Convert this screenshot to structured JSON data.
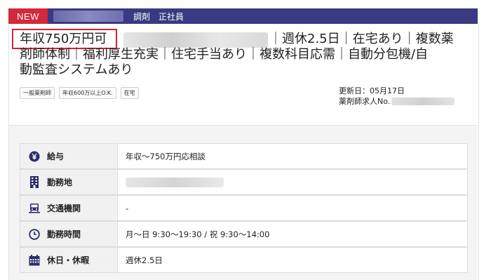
{
  "topbar": {
    "new_label": "NEW",
    "tags": [
      "調剤",
      "正社員"
    ]
  },
  "title": {
    "highlight": "年収750万円可",
    "rest_line1": "｜週休2.5日｜在宅あり｜複数薬",
    "line2": "剤師体制｜福利厚生充実｜住宅手当あり｜複数科目応需｜自動分包機/自",
    "line3": "動監査システムあり"
  },
  "chips": [
    "一般薬剤師",
    "年収600万以上O.K.",
    "在宅"
  ],
  "meta": {
    "updated": "更新日：05月17日",
    "job_no_label": "薬剤師求人No."
  },
  "rows": [
    {
      "label": "給与",
      "icon": "yen-icon",
      "value": "年収～750万円応相談"
    },
    {
      "label": "勤務地",
      "icon": "building-icon",
      "value": ""
    },
    {
      "label": "交通機関",
      "icon": "train-icon",
      "value": "-"
    },
    {
      "label": "勤務時間",
      "icon": "clock-icon",
      "value": "月～日 9:30～19:30 / 祝 9:30～14:00"
    },
    {
      "label": "休日・休暇",
      "icon": "calendar-icon",
      "value": "週休2.5日"
    }
  ],
  "colors": {
    "topbar": "#3a3983",
    "new_badge": "#d3293a",
    "highlight_border": "#d3233a",
    "icon_navy": "#2c2c70"
  }
}
